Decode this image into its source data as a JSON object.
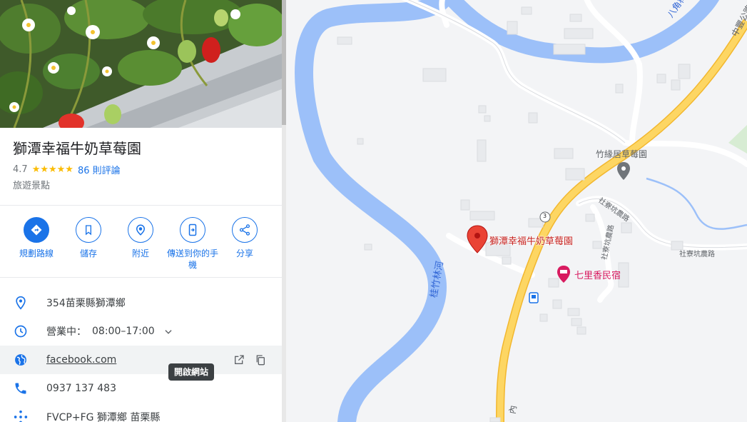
{
  "place": {
    "title": "獅潭幸福牛奶草莓園",
    "rating": "4.7",
    "stars": "★★★★★",
    "reviews": "86 則評論",
    "category": "旅遊景點"
  },
  "actions": [
    {
      "label": "規劃路線",
      "icon": "directions-icon"
    },
    {
      "label": "儲存",
      "icon": "bookmark-icon"
    },
    {
      "label": "附近",
      "icon": "nearby-icon"
    },
    {
      "label": "傳送到你的手機",
      "icon": "send-to-phone-icon"
    },
    {
      "label": "分享",
      "icon": "share-icon"
    }
  ],
  "info": {
    "address": "354苗栗縣獅潭鄉",
    "hours_status": "營業中：",
    "hours": "08:00–17:00",
    "website": "facebook.com",
    "phone": "0937 137 483",
    "plus_code": "FVCP+FG 獅潭鄉 苗栗縣"
  },
  "tooltip": "開啟網站",
  "map": {
    "pin_label": "獅潭幸福牛奶草莓園",
    "poi_1": "竹緣居草莓園",
    "poi_2": "七里香民宿",
    "river_1": "八角林河",
    "river_2": "桂竹林河",
    "road_1": "社寮坑農路",
    "road_2": "社寮坑農路",
    "road_3": "社寮坑農路",
    "highway": "中豐公路",
    "route_num": "3",
    "road_bottom": "內"
  },
  "colors": {
    "accent": "#1a73e8",
    "star": "#fbbc04",
    "river": "#9cc0f9",
    "highway": "#fdd663",
    "pin": "#ea4335",
    "hotel": "#d81b60"
  }
}
